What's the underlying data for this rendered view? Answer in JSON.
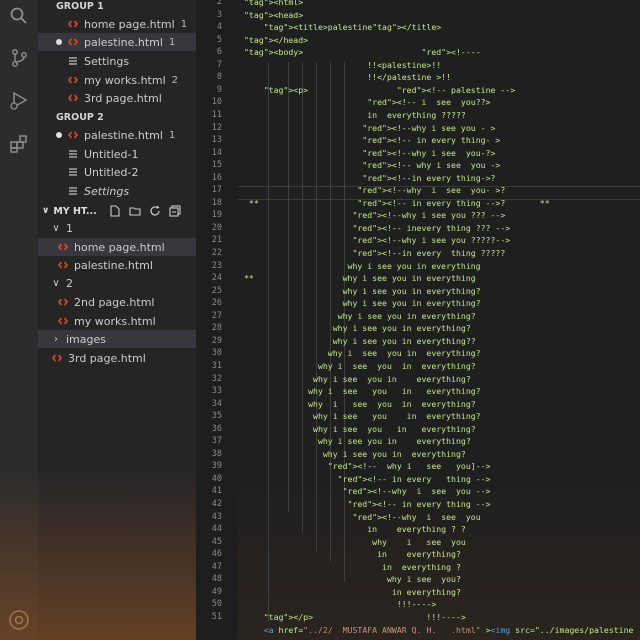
{
  "sidebar": {
    "group1_label": "GROUP 1",
    "group1_items": [
      {
        "label": "home page.html",
        "badge": "1",
        "type": "html"
      },
      {
        "label": "palestine.html",
        "badge": "1",
        "type": "html",
        "dot": true,
        "selected": true
      },
      {
        "label": "Settings",
        "badge": "",
        "type": "settings"
      },
      {
        "label": "my works.html",
        "badge": "2",
        "type": "html"
      },
      {
        "label": "3rd page.html",
        "badge": "",
        "type": "html"
      }
    ],
    "group2_label": "GROUP 2",
    "group2_items": [
      {
        "label": "palestine.html",
        "badge": "1",
        "type": "html",
        "dot": true
      },
      {
        "label": "Untitled-1",
        "badge": "",
        "type": "text"
      },
      {
        "label": "Untitled-2",
        "badge": "",
        "type": "text"
      },
      {
        "label": "Settings",
        "badge": "",
        "type": "text",
        "italic": true
      }
    ],
    "explorer_header": "MY HT...",
    "tree": [
      {
        "label": "1",
        "kind": "folder-open",
        "indent": 0
      },
      {
        "label": "home page.html",
        "kind": "html",
        "indent": 1,
        "selected": true
      },
      {
        "label": "palestine.html",
        "kind": "html",
        "indent": 1
      },
      {
        "label": "2",
        "kind": "folder-open",
        "indent": 0
      },
      {
        "label": "2nd page.html",
        "kind": "html",
        "indent": 1
      },
      {
        "label": "my works.html",
        "kind": "html",
        "indent": 1
      },
      {
        "label": "images",
        "kind": "folder-closed",
        "indent": 0,
        "selected": true
      },
      {
        "label": "3rd page.html",
        "kind": "html",
        "indent": 0
      }
    ]
  },
  "editor": {
    "line_numbers": [
      "2",
      "3",
      "4",
      "5",
      "6",
      "7",
      "8",
      "9",
      "10",
      "11",
      "12",
      "13",
      "14",
      "15",
      "16",
      "17",
      "18",
      "19",
      "20",
      "21",
      "22",
      "23",
      "24",
      "25",
      "26",
      "27",
      "28",
      "29",
      "30",
      "31",
      "32",
      "33",
      "34",
      "35",
      "36",
      "37",
      "38",
      "39",
      "40",
      "41",
      "42",
      "43",
      "44",
      "45",
      "46",
      "47",
      "48",
      "49",
      "50",
      "51"
    ],
    "lines": [
      "<html>",
      "<head>",
      "    <title>palestine</title>",
      "</head>",
      "<body>                        <!----",
      "                         !!<palestine>!!",
      "                         !!</palestine >!!",
      "    <p>                  <!-- palestine -->",
      "                         <!-- i  see  you??>",
      "                         in  everything ?????",
      "                        <!--why i see you - >",
      "                        <!-- in every thing- >",
      "                        <!--why i see  you-?>",
      "                        <!-- why i see  you ->",
      "                        <!--in every thing->?",
      "                       <!--why  i  see  you- >?",
      " **                    <!-- in every thing -->?       **",
      "                      <!--why i see you ??? -->",
      "                      <!-- inevery thing ??? -->",
      "                      <!--why i see you ?????-->",
      "                      <!--in every  thing ?????",
      "                     why i see you in everything",
      "**                  why i see you in everything",
      "                    why i see you in everything?",
      "                    why i see you in everything?",
      "                   why i see you in everything?",
      "                  why i see you in everything?",
      "                  why i see you in everything??",
      "                 why i  see  you in  everything?",
      "               why i  see  you  in  everything?",
      "              why i see  you in    everything?",
      "             why i  see   you   in   everything?",
      "             why  i   see  you  in  everything?",
      "              why i see   you    in  everything?",
      "              why i see  you   in   everything?",
      "               why i see you in    everything?",
      "                why i see you in  everything?",
      "                 <!--  why i   see   you]-->",
      "                   <!-- in every   thing -->",
      "                    <!--why  i  see  you -->",
      "                     <!-- in every thing -->",
      "                      <!--why  i  see  you",
      "                         in    everything ? ?",
      "                          why    i   see  you",
      "                           in    everything?",
      "                            in  everything ?",
      "                             why i see  you?",
      "                              in everything?",
      "                               !!!---->",
      "    </p>                       !!!---->",
      "    <a href=\"../2/  MUSTAFA ANWAR Q. H.   .html\" ><img src=\"../images/palestine"
    ]
  }
}
